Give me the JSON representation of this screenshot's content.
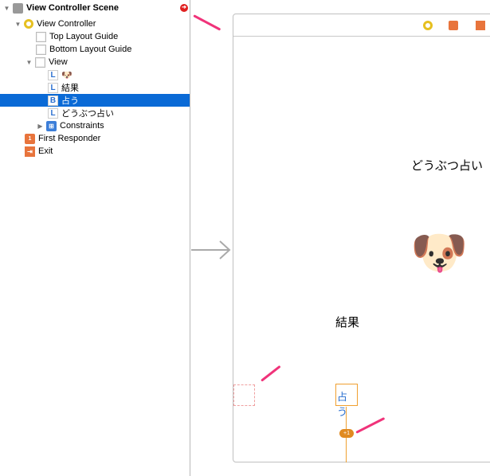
{
  "outline": {
    "scene": "View Controller Scene",
    "items": [
      {
        "label": "View Controller",
        "icon": "view-controller-icon"
      },
      {
        "label": "Top Layout Guide",
        "icon": "layout-guide-icon"
      },
      {
        "label": "Bottom Layout Guide",
        "icon": "layout-guide-icon"
      },
      {
        "label": "View",
        "icon": "view-icon"
      },
      {
        "label": "🐶",
        "icon": "label-icon",
        "badge": "L"
      },
      {
        "label": "結果",
        "icon": "label-icon",
        "badge": "L"
      },
      {
        "label": "占う",
        "icon": "button-icon",
        "badge": "B",
        "selected": true
      },
      {
        "label": "どうぶつ占い",
        "icon": "label-icon",
        "badge": "L"
      },
      {
        "label": "Constraints",
        "icon": "constraints-icon"
      },
      {
        "label": "First Responder",
        "icon": "first-responder-icon"
      },
      {
        "label": "Exit",
        "icon": "exit-icon"
      }
    ]
  },
  "canvas": {
    "title_label": "どうぶつ占い",
    "emoji": "🐶",
    "result_label": "結果",
    "button_label": "占う",
    "constraint_badge": "+1"
  },
  "colors": {
    "selection": "#0a6ad6",
    "arrow": "#f0337a",
    "constraint": "#f0a030",
    "warning": "#e02020"
  }
}
